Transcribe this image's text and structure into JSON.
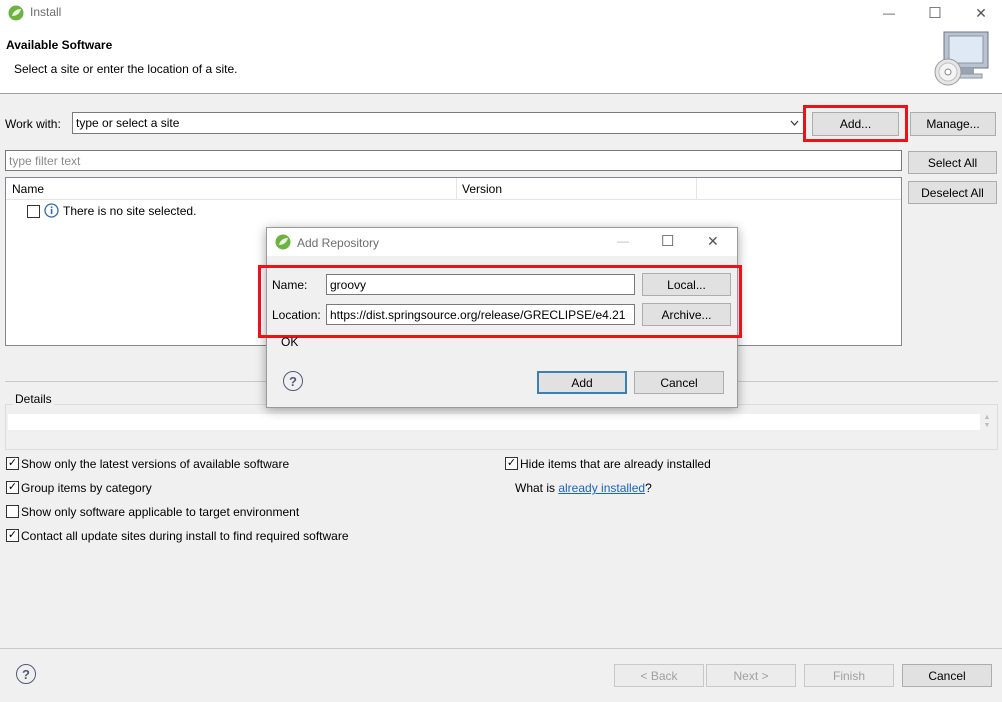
{
  "window": {
    "title": "Install",
    "min": "—",
    "max": "☐",
    "close": "✕"
  },
  "header": {
    "title": "Available Software",
    "subtitle": "Select a site or enter the location of a site."
  },
  "work_with": {
    "label": "Work with:",
    "value": "type or select a site",
    "add_label": "Add...",
    "manage_label": "Manage..."
  },
  "filter": {
    "placeholder": "type filter text"
  },
  "table": {
    "columns": [
      "Name",
      "Version"
    ],
    "empty_message": "There is no site selected."
  },
  "side_buttons": {
    "select_all": "Select All",
    "deselect_all": "Deselect All"
  },
  "details": {
    "label": "Details"
  },
  "options": {
    "latest": {
      "label": "Show only the latest versions of available software",
      "checked": true
    },
    "group": {
      "label": "Group items by category",
      "checked": true
    },
    "applicable": {
      "label": "Show only software applicable to target environment",
      "checked": false
    },
    "contact": {
      "label": "Contact all update sites during install to find required software",
      "checked": true
    },
    "hide_installed": {
      "label": "Hide items that are already installed",
      "checked": true
    },
    "what_is_prefix": "What is ",
    "what_is_link": "already installed",
    "what_is_suffix": "?"
  },
  "footer": {
    "back": "< Back",
    "next": "Next >",
    "finish": "Finish",
    "cancel": "Cancel",
    "help": "?"
  },
  "dialog": {
    "title": "Add Repository",
    "name_label": "Name:",
    "name_value": "groovy",
    "location_label": "Location:",
    "location_value": "https://dist.springsource.org/release/GRECLIPSE/e4.21",
    "local_label": "Local...",
    "archive_label": "Archive...",
    "status": "OK",
    "add_label": "Add",
    "cancel_label": "Cancel",
    "help": "?"
  },
  "colors": {
    "highlight": "#e8141a",
    "link": "#1a62c8",
    "default_button_border": "#3c7fb1"
  }
}
